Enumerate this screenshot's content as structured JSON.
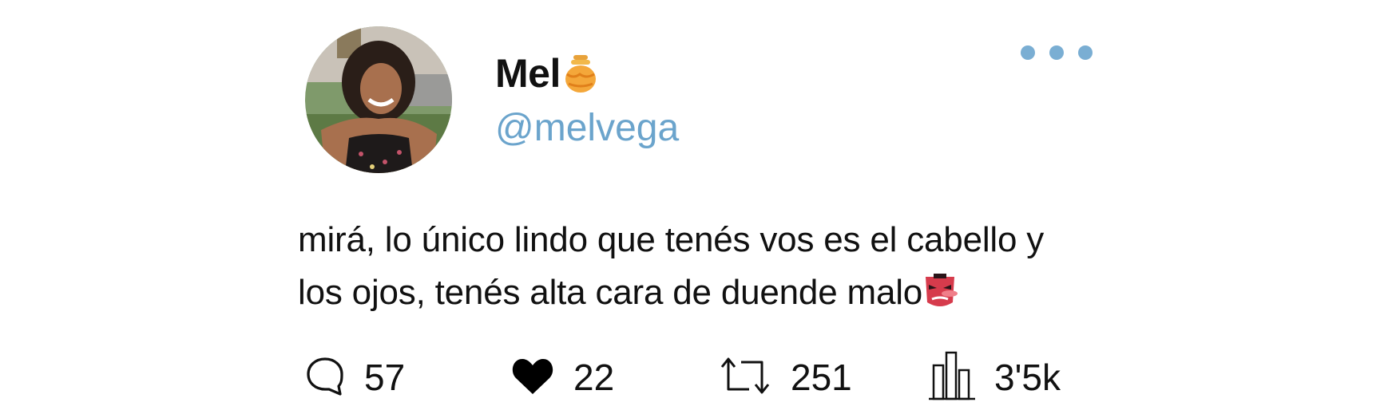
{
  "author": {
    "display_name": "Mel",
    "name_emoji": "honey-pot-icon",
    "handle": "@melvega",
    "avatar": "profile-photo"
  },
  "menu": {
    "icon": "more-dots-icon"
  },
  "tweet": {
    "text_line1": "mirá, lo único lindo que tenés vos es el cabello y",
    "text_line2": "los ojos, tenés alta cara de duende malo",
    "trailing_emoji": "goblin-icon"
  },
  "actions": {
    "replies": {
      "icon": "reply-icon",
      "count": "57"
    },
    "likes": {
      "icon": "heart-icon",
      "count": "22"
    },
    "retweets": {
      "icon": "retweet-icon",
      "count": "251"
    },
    "views": {
      "icon": "views-icon",
      "count": "3'5k"
    }
  },
  "colors": {
    "handle": "#6ba4cc",
    "more_dots": "#7aaed3",
    "text": "#111111",
    "background": "#ffffff"
  }
}
